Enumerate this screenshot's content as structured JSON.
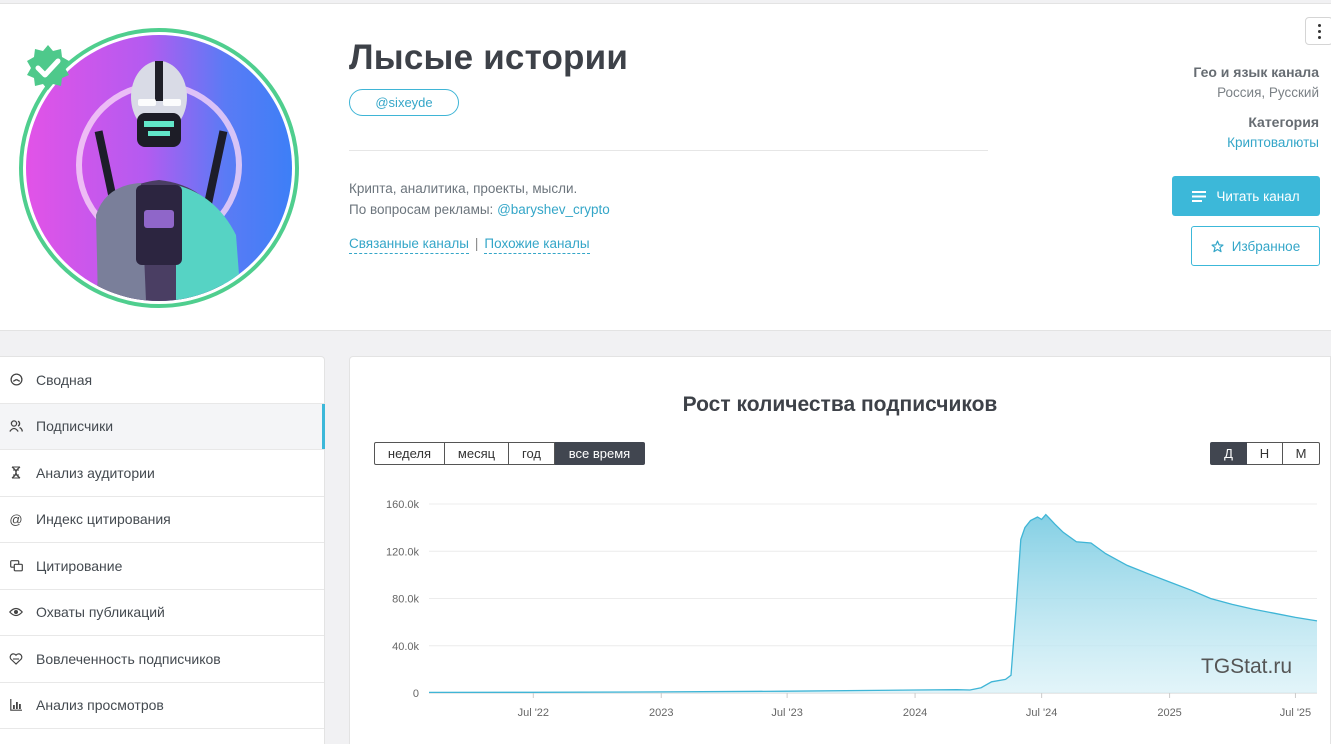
{
  "channel": {
    "title": "Лысые истории",
    "handle": "@sixeyde",
    "description_line1": "Крипта, аналитика, проекты, мысли.",
    "description_line2_prefix": "По вопросам рекламы: ",
    "ad_contact": "@baryshev_crypto",
    "related_link": "Связанные каналы",
    "separator": "|",
    "similar_link": "Похожие каналы",
    "geo_label": "Гео и язык канала",
    "geo_value": "Россия, Русский",
    "category_label": "Категория",
    "category_value": "Криптовалюты",
    "read_button": "Читать канал",
    "favorite_button": "Избранное",
    "verified_icon": "verified-badge-icon",
    "colors": {
      "accent": "#3cb8d9",
      "verified": "#4fce8e"
    }
  },
  "sidebar": {
    "items": [
      {
        "label": "Сводная",
        "icon": "dashboard-icon"
      },
      {
        "label": "Подписчики",
        "icon": "users-icon",
        "active": true
      },
      {
        "label": "Анализ аудитории",
        "icon": "dna-icon"
      },
      {
        "label": "Индекс цитирования",
        "icon": "at-icon"
      },
      {
        "label": "Цитирование",
        "icon": "quote-icon"
      },
      {
        "label": "Охваты публикаций",
        "icon": "eye-icon"
      },
      {
        "label": "Вовлеченность подписчиков",
        "icon": "engagement-icon"
      },
      {
        "label": "Анализ просмотров",
        "icon": "bar-chart-icon"
      }
    ]
  },
  "chart_section": {
    "title": "Рост количества подписчиков",
    "range_buttons": [
      "неделя",
      "месяц",
      "год",
      "все время"
    ],
    "range_selected": "все время",
    "granularity_buttons": [
      "Д",
      "Н",
      "М"
    ],
    "granularity_selected": "Д",
    "watermark": "TGStat.ru"
  },
  "chart_data": {
    "type": "area",
    "title": "Рост количества подписчиков",
    "xlabel": "",
    "ylabel": "",
    "y_ticks": [
      "0",
      "40.0k",
      "80.0k",
      "120.0k",
      "160.0k"
    ],
    "ylim": [
      0,
      160000
    ],
    "x_ticks": [
      "Jul '22",
      "2023",
      "Jul '23",
      "2024",
      "Jul '24",
      "2025",
      "Jul '25"
    ],
    "x_tick_dates": [
      "2022-07-01",
      "2023-01-01",
      "2023-07-01",
      "2024-01-01",
      "2024-07-01",
      "2025-01-01",
      "2025-07-01"
    ],
    "xlim": [
      "2022-02-01",
      "2025-08-01"
    ],
    "grid": true,
    "legend": "none",
    "x": [
      "2022-02-01",
      "2022-07-01",
      "2023-01-01",
      "2023-07-01",
      "2024-01-01",
      "2024-03-01",
      "2024-03-20",
      "2024-04-05",
      "2024-04-20",
      "2024-05-10",
      "2024-05-18",
      "2024-05-25",
      "2024-06-01",
      "2024-06-07",
      "2024-06-15",
      "2024-06-25",
      "2024-07-01",
      "2024-07-07",
      "2024-07-12",
      "2024-07-20",
      "2024-08-01",
      "2024-08-20",
      "2024-09-10",
      "2024-10-01",
      "2024-11-01",
      "2024-12-01",
      "2025-01-01",
      "2025-02-01",
      "2025-03-01",
      "2025-04-01",
      "2025-05-01",
      "2025-06-01",
      "2025-07-01",
      "2025-08-01"
    ],
    "series": [
      {
        "values": [
          500,
          600,
          900,
          1500,
          2500,
          2800,
          2500,
          4500,
          9500,
          11500,
          15000,
          70000,
          130000,
          140000,
          146000,
          149000,
          147000,
          151000,
          148000,
          143000,
          136000,
          128000,
          127000,
          118000,
          108000,
          101000,
          94000,
          87000,
          80000,
          75000,
          71000,
          67500,
          64000,
          61000
        ]
      }
    ]
  }
}
